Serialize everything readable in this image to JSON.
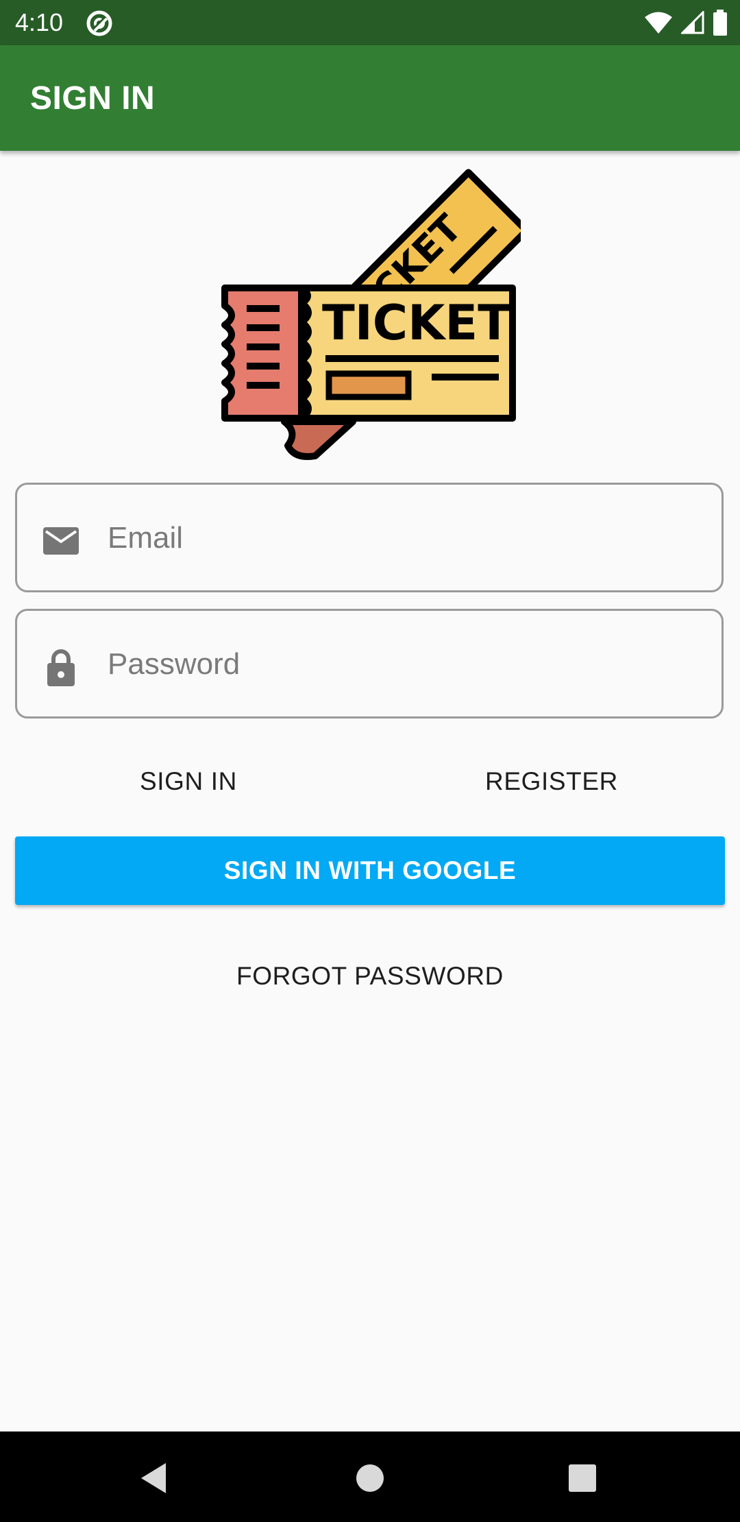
{
  "status_bar": {
    "time": "4:10",
    "icons": [
      "app-notification-icon",
      "wifi-icon",
      "signal-icon",
      "battery-icon"
    ]
  },
  "app_bar": {
    "title": "SIGN IN",
    "color": "#327f33"
  },
  "logo": {
    "front_ticket_text": "TICKET",
    "back_ticket_text": "CKET"
  },
  "form": {
    "email": {
      "placeholder": "Email",
      "value": "",
      "icon": "email-icon"
    },
    "password": {
      "placeholder": "Password",
      "value": "",
      "icon": "lock-icon"
    }
  },
  "actions": {
    "sign_in_label": "SIGN IN",
    "register_label": "REGISTER",
    "google_label": "SIGN IN WITH GOOGLE",
    "google_color": "#03a9f4",
    "forgot_label": "FORGOT PASSWORD"
  },
  "nav_bar": {
    "icons": [
      "back-icon",
      "home-icon",
      "recents-icon"
    ]
  }
}
